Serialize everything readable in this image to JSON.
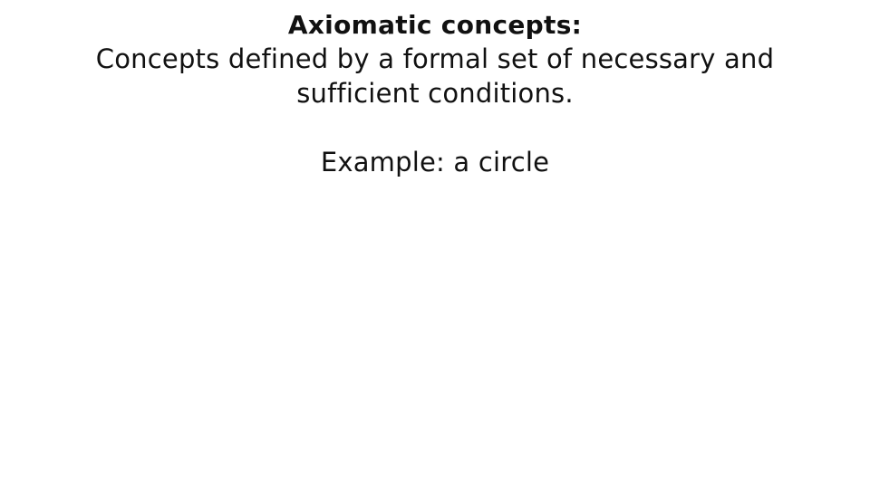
{
  "slide": {
    "heading": "Axiomatic concepts:",
    "definition": "Concepts defined by a formal set of necessary and sufficient conditions.",
    "example": "Example: a circle"
  },
  "colors": {
    "background": "#ffffff",
    "text": "#111111"
  }
}
